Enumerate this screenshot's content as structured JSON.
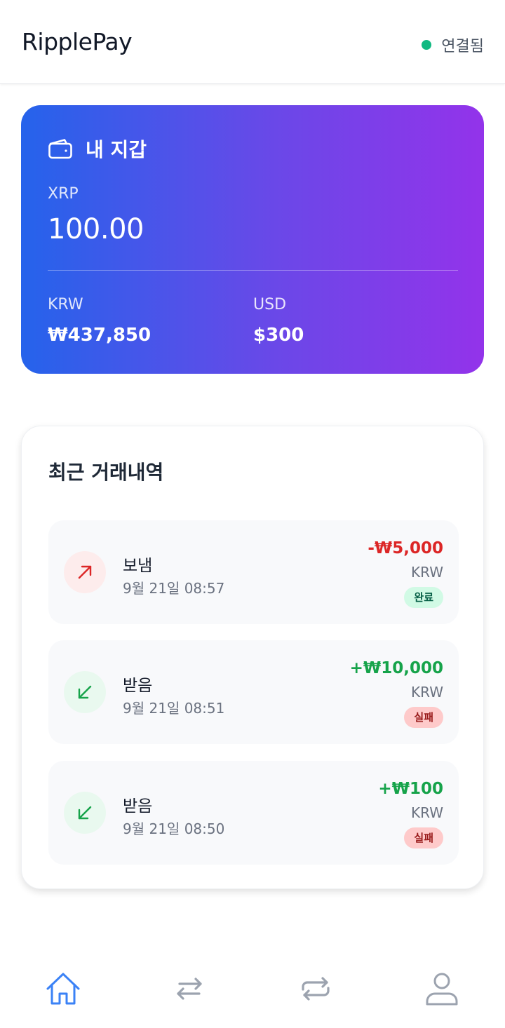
{
  "app": {
    "title": "RipplePay"
  },
  "connection": {
    "status": "연결됨",
    "color": "#10b981"
  },
  "wallet": {
    "title": "내 지갑",
    "icon": "wallet-icon",
    "xrp_label": "XRP",
    "xrp_balance": "100.00",
    "krw_label": "KRW",
    "krw_value": "₩437,850",
    "usd_label": "USD",
    "usd_value": "$300",
    "gradient": [
      "#2563eb",
      "#9333ea"
    ]
  },
  "transactions": {
    "title": "최근 거래내역",
    "items": [
      {
        "type": "보냄",
        "direction": "sent",
        "icon": "arrow-up-right-icon",
        "time": "9월 21일 08:57",
        "amount": "-₩5,000",
        "currency": "KRW",
        "status": "완료"
      },
      {
        "type": "받음",
        "direction": "received",
        "icon": "arrow-down-left-icon",
        "time": "9월 21일 08:51",
        "amount": "+₩10,000",
        "currency": "KRW",
        "status": "실패"
      },
      {
        "type": "받음",
        "direction": "received",
        "icon": "arrow-down-left-icon",
        "time": "9월 21일 08:50",
        "amount": "+₩100",
        "currency": "KRW",
        "status": "실패"
      }
    ]
  },
  "nav": {
    "items": [
      {
        "icon": "home-icon",
        "active": true
      },
      {
        "icon": "transfer-icon",
        "active": false
      },
      {
        "icon": "exchange-icon",
        "active": false
      },
      {
        "icon": "user-icon",
        "active": false
      }
    ],
    "active_color": "#3b82f6",
    "inactive_color": "#9ca3af"
  }
}
